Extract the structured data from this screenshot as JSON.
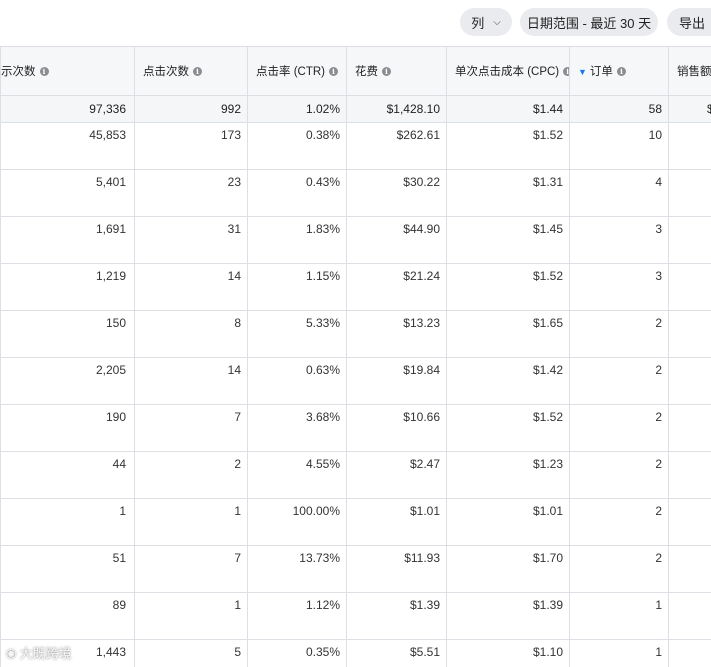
{
  "toolbar": {
    "columns_label": "列",
    "date_range_label": "日期范围 - 最近 30 天",
    "export_label": "导出"
  },
  "table": {
    "headers": [
      "示次数",
      "点击次数",
      "点击率 (CTR)",
      "花费",
      "单次点击成本 (CPC)",
      "订单",
      "销售额"
    ],
    "sorted_column": "订单",
    "total": [
      "97,336",
      "992",
      "1.02%",
      "$1,428.10",
      "$1.44",
      "58",
      "$"
    ],
    "rows": [
      [
        "45,853",
        "173",
        "0.38%",
        "$262.61",
        "$1.52",
        "10"
      ],
      [
        "5,401",
        "23",
        "0.43%",
        "$30.22",
        "$1.31",
        "4"
      ],
      [
        "1,691",
        "31",
        "1.83%",
        "$44.90",
        "$1.45",
        "3"
      ],
      [
        "1,219",
        "14",
        "1.15%",
        "$21.24",
        "$1.52",
        "3"
      ],
      [
        "150",
        "8",
        "5.33%",
        "$13.23",
        "$1.65",
        "2"
      ],
      [
        "2,205",
        "14",
        "0.63%",
        "$19.84",
        "$1.42",
        "2"
      ],
      [
        "190",
        "7",
        "3.68%",
        "$10.66",
        "$1.52",
        "2"
      ],
      [
        "44",
        "2",
        "4.55%",
        "$2.47",
        "$1.23",
        "2"
      ],
      [
        "1",
        "1",
        "100.00%",
        "$1.01",
        "$1.01",
        "2"
      ],
      [
        "51",
        "7",
        "13.73%",
        "$11.93",
        "$1.70",
        "2"
      ],
      [
        "89",
        "1",
        "1.12%",
        "$1.39",
        "$1.39",
        "1"
      ],
      [
        "1,443",
        "5",
        "0.35%",
        "$5.51",
        "$1.10",
        "1"
      ]
    ]
  },
  "watermark": "大既跨境",
  "icons": {
    "info": "info-icon",
    "sort": "sort-desc-icon",
    "chevron": "chevron-down-icon"
  }
}
